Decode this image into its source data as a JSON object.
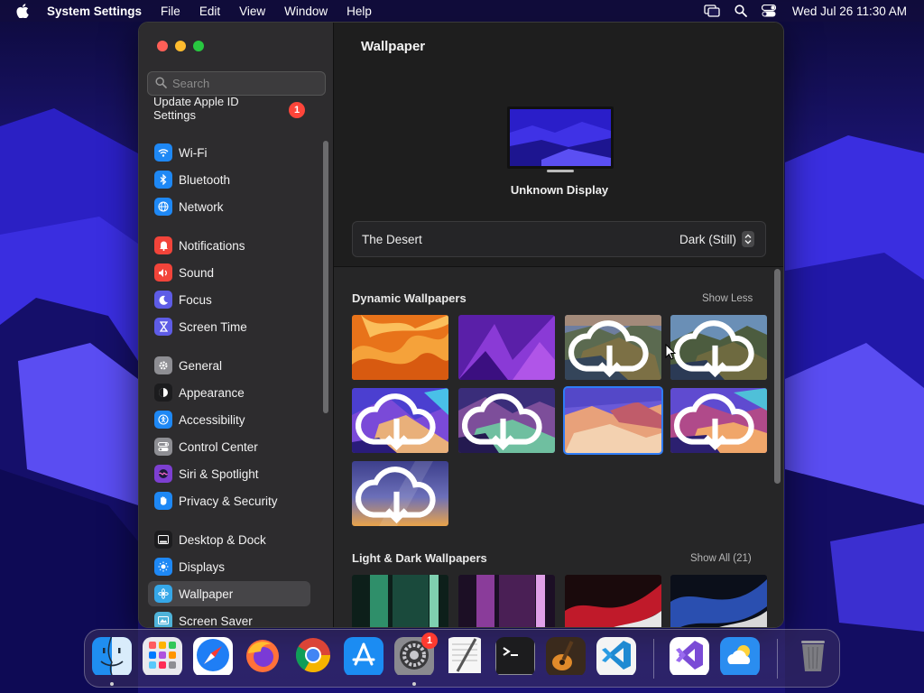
{
  "menubar": {
    "app_name": "System Settings",
    "items": [
      "File",
      "Edit",
      "View",
      "Window",
      "Help"
    ],
    "clock": "Wed Jul 26  11:30 AM"
  },
  "sidebar": {
    "search_placeholder": "Search",
    "apple_id": {
      "label": "Update Apple ID\nSettings",
      "badge": "1"
    },
    "items": [
      {
        "label": "Wi-Fi",
        "icon": "wifi-icon",
        "color": "#1e88f5"
      },
      {
        "label": "Bluetooth",
        "icon": "bluetooth-icon",
        "color": "#1e88f5"
      },
      {
        "label": "Network",
        "icon": "globe-icon",
        "color": "#1e88f5"
      },
      {
        "label": "Notifications",
        "icon": "bell-icon",
        "color": "#f2443a"
      },
      {
        "label": "Sound",
        "icon": "speaker-icon",
        "color": "#f2443a"
      },
      {
        "label": "Focus",
        "icon": "moon-icon",
        "color": "#5e5ce6"
      },
      {
        "label": "Screen Time",
        "icon": "hourglass-icon",
        "color": "#5e5ce6"
      },
      {
        "label": "General",
        "icon": "gear-icon",
        "color": "#8e8e93"
      },
      {
        "label": "Appearance",
        "icon": "appearance-icon",
        "color": "#1c1c1e"
      },
      {
        "label": "Accessibility",
        "icon": "accessibility-icon",
        "color": "#1e88f5"
      },
      {
        "label": "Control Center",
        "icon": "control-center-icon",
        "color": "#8e8e93"
      },
      {
        "label": "Siri & Spotlight",
        "icon": "siri-icon",
        "color": "#7d3fd1"
      },
      {
        "label": "Privacy & Security",
        "icon": "hand-icon",
        "color": "#1e88f5"
      },
      {
        "label": "Desktop & Dock",
        "icon": "dock-icon",
        "color": "#1c1c1e"
      },
      {
        "label": "Displays",
        "icon": "sun-icon",
        "color": "#1e88f5"
      },
      {
        "label": "Wallpaper",
        "icon": "wallpaper-icon",
        "color": "#35a7e8"
      },
      {
        "label": "Screen Saver",
        "icon": "screensaver-icon",
        "color": "#4fb3d9"
      }
    ],
    "selected": "Wallpaper"
  },
  "main": {
    "title": "Wallpaper",
    "display_name": "Unknown Display",
    "current_wallpaper": "The Desert",
    "current_mode": "Dark (Still)",
    "sections": [
      {
        "title": "Dynamic Wallpapers",
        "link": "Show Less"
      },
      {
        "title": "Light & Dark Wallpapers",
        "link": "Show All (21)"
      }
    ]
  },
  "dock": {
    "apps": [
      {
        "name": "Finder",
        "icon": "finder-icon",
        "running": true
      },
      {
        "name": "Launchpad",
        "icon": "launchpad-icon",
        "running": false
      },
      {
        "name": "Safari",
        "icon": "safari-icon",
        "running": false
      },
      {
        "name": "Firefox",
        "icon": "firefox-icon",
        "running": false
      },
      {
        "name": "Chrome",
        "icon": "chrome-icon",
        "running": false
      },
      {
        "name": "App Store",
        "icon": "app-store-icon",
        "running": false
      },
      {
        "name": "System Settings",
        "icon": "system-settings-icon",
        "running": true,
        "badge": "1"
      },
      {
        "name": "TextEdit",
        "icon": "textedit-icon",
        "running": false
      },
      {
        "name": "Terminal",
        "icon": "terminal-icon",
        "running": false
      },
      {
        "name": "GarageBand",
        "icon": "garageband-icon",
        "running": false
      },
      {
        "name": "Visual Studio Code",
        "icon": "vscode-icon",
        "running": false
      },
      {
        "name": "Visual Studio",
        "icon": "visual-studio-icon",
        "running": false
      },
      {
        "name": "Weather",
        "icon": "weather-icon",
        "running": false
      },
      {
        "name": "Trash",
        "icon": "trash-icon",
        "running": false
      }
    ]
  }
}
